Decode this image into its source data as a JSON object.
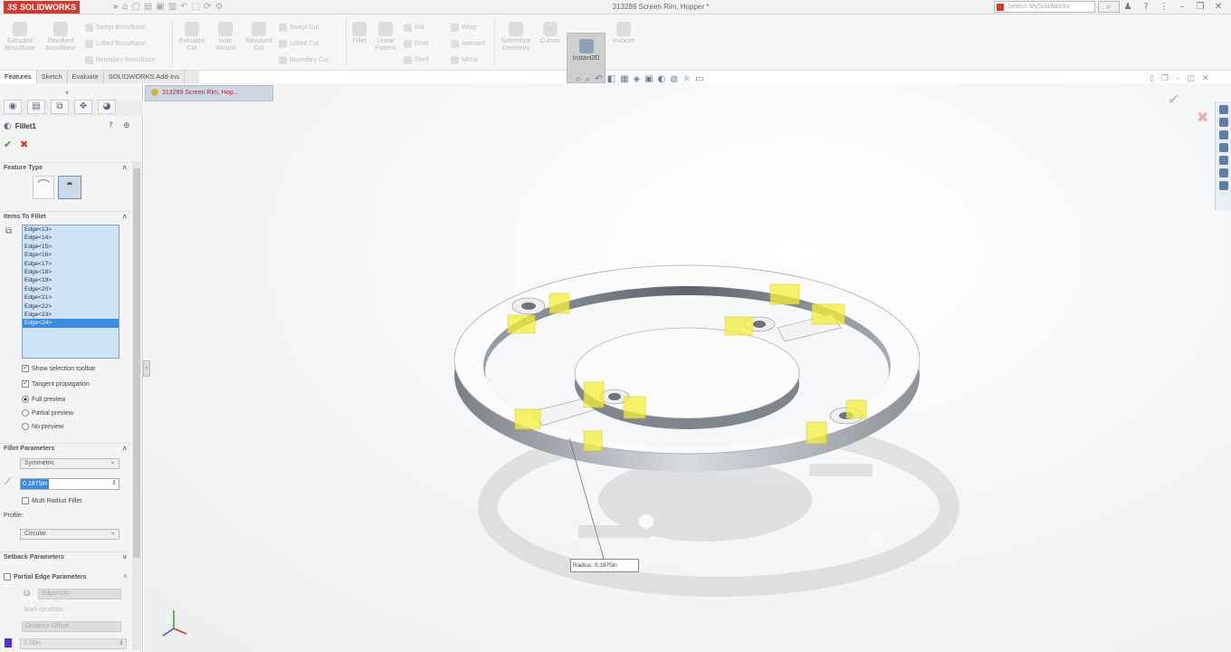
{
  "app": {
    "brand": "SOLIDWORKS",
    "brand_prefix": "3S",
    "document_title": "313289 Screen Rim, Hopper *",
    "search_placeholder": "Search MySolidWorks"
  },
  "ribbon": {
    "large_buttons": [
      {
        "label": "Extruded Boss/Base"
      },
      {
        "label": "Revolved Boss/Base"
      },
      {
        "label": "Extruded Cut"
      },
      {
        "label": "Hole Wizard"
      },
      {
        "label": "Revolved Cut"
      },
      {
        "label": "Fillet"
      },
      {
        "label": "Linear Pattern"
      },
      {
        "label": "Reference Geometry"
      },
      {
        "label": "Curves"
      },
      {
        "label": "Instant3D"
      },
      {
        "label": "Invoicer"
      }
    ],
    "small_buttons": [
      "Swept Boss/Base",
      "Lofted Boss/Base",
      "Boundary Boss/Base",
      "Swept Cut",
      "Lofted Cut",
      "Boundary Cut",
      "Rib",
      "Draft",
      "Shell",
      "Wrap",
      "Intersect",
      "Mirror"
    ]
  },
  "tabs": [
    {
      "label": "Features",
      "active": true
    },
    {
      "label": "Sketch",
      "active": false
    },
    {
      "label": "Evaluate",
      "active": false
    },
    {
      "label": "SOLIDWORKS Add-Ins",
      "active": false
    }
  ],
  "document_tab": "313289 Screen Rim, Hop...",
  "feature": {
    "name": "Fillet1",
    "ok": "✔",
    "cancel": "✖"
  },
  "panel": {
    "feature_type_header": "Feature Type",
    "items_header": "Items To Fillet",
    "edges": [
      "Edge<13>",
      "Edge<14>",
      "Edge<15>",
      "Edge<16>",
      "Edge<17>",
      "Edge<18>",
      "Edge<19>",
      "Edge<20>",
      "Edge<21>",
      "Edge<22>",
      "Edge<23>",
      "Edge<24>"
    ],
    "selected_edge_index": 11,
    "show_selection_toolbar": "Show selection toolbar",
    "tangent_propagation": "Tangent propagation",
    "full_preview": "Full preview",
    "partial_preview": "Partial preview",
    "no_preview": "No preview",
    "fillet_params_header": "Fillet Parameters",
    "symmetric": "Symmetric",
    "radius_value": "0.1875in",
    "multi_radius": "Multi Radius Fillet",
    "profile_label": "Profile:",
    "profile_value": "Circular",
    "setback_header": "Setback Parameters",
    "partial_edge_header": "Partial Edge Parameters",
    "edge_placeholder": "Edge<24>",
    "start_condition": "Start condition",
    "distance_offset": "Distance Offset",
    "offset_value": "0.00in"
  },
  "viewport": {
    "radius_callout": "Radius: 0.1875in"
  },
  "colors": {
    "brand_red": "#d23a2e",
    "selection_blue": "#3b8be0",
    "highlight_yellow": "#f3f03a"
  }
}
